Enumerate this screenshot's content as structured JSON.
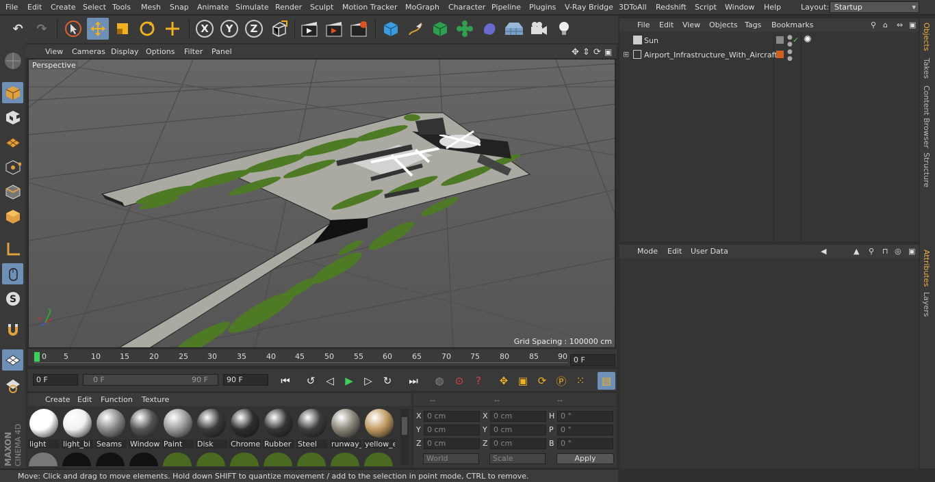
{
  "menubar": {
    "items": [
      "File",
      "Edit",
      "Create",
      "Select",
      "Tools",
      "Mesh",
      "Snap",
      "Animate",
      "Simulate",
      "Render",
      "Sculpt",
      "Motion Tracker",
      "MoGraph",
      "Character",
      "Pipeline",
      "Plugins",
      "V-Ray Bridge",
      "3DToAll",
      "Redshift",
      "Script",
      "Window",
      "Help"
    ],
    "layout_label": "Layout:",
    "layout_value": "Startup"
  },
  "toolbar": {
    "icons": [
      "undo-icon",
      "redo-icon",
      "select-icon",
      "move-icon",
      "scale-icon",
      "rotate-icon",
      "live-select-icon",
      "x-axis-icon",
      "y-axis-icon",
      "z-axis-icon",
      "coordinate-system-icon",
      "render-view-icon",
      "render-picture-viewer-icon",
      "render-settings-icon",
      "cube-icon",
      "pen-icon",
      "subdivision-icon",
      "array-icon",
      "deformer-icon",
      "floor-icon",
      "camera-icon",
      "light-icon"
    ],
    "axis_labels": [
      "X",
      "Y",
      "Z"
    ]
  },
  "viewport": {
    "menu": [
      "View",
      "Cameras",
      "Display",
      "Options",
      "Filter",
      "Panel"
    ],
    "label": "Perspective",
    "grid_spacing": "Grid Spacing : 100000 cm",
    "colors": {
      "bg": "#5b5b5b",
      "grass": "#4f7a25",
      "tarmac": "#b8b8b0"
    }
  },
  "timeline": {
    "ticks": [
      "0",
      "5",
      "10",
      "15",
      "20",
      "25",
      "30",
      "35",
      "40",
      "45",
      "50",
      "55",
      "60",
      "65",
      "70",
      "75",
      "80",
      "85",
      "90"
    ],
    "current_frame": "0 F"
  },
  "playbar": {
    "start": "0 F",
    "range_start": "0 F",
    "range_end": "90 F",
    "end": "90 F"
  },
  "materials": {
    "menu": [
      "Create",
      "Edit",
      "Function",
      "Texture"
    ],
    "items": [
      {
        "name": "light",
        "color": "#ffffff"
      },
      {
        "name": "light_bi",
        "color": "#f0f0f0"
      },
      {
        "name": "Seams",
        "color": "#8a8a8a"
      },
      {
        "name": "Window",
        "color": "#555555"
      },
      {
        "name": "Paint",
        "color": "#9a9a9a"
      },
      {
        "name": "Disk",
        "color": "#3a3a3a"
      },
      {
        "name": "Chrome",
        "color": "#2e2e2e"
      },
      {
        "name": "Rubber",
        "color": "#353535"
      },
      {
        "name": "Steel",
        "color": "#3d3d3d"
      },
      {
        "name": "runway_",
        "color": "#8a8578"
      },
      {
        "name": "yellow_e",
        "color": "#c09a60"
      }
    ]
  },
  "coordinates": {
    "headers": [
      "--",
      "--",
      "--"
    ],
    "rows": [
      {
        "l1": "X",
        "v1": "0 cm",
        "l2": "X",
        "v2": "0 cm",
        "l3": "H",
        "v3": "0 °"
      },
      {
        "l1": "Y",
        "v1": "0 cm",
        "l2": "Y",
        "v2": "0 cm",
        "l3": "P",
        "v3": "0 °"
      },
      {
        "l1": "Z",
        "v1": "0 cm",
        "l2": "Z",
        "v2": "0 cm",
        "l3": "B",
        "v3": "0 °"
      }
    ],
    "mode_world": "World",
    "mode_scale": "Scale",
    "apply": "Apply"
  },
  "status": "Move: Click and drag to move elements. Hold down SHIFT to quantize movement / add to the selection in point mode, CTRL to remove.",
  "objects": {
    "menu": [
      "File",
      "Edit",
      "View",
      "Objects",
      "Tags",
      "Bookmarks"
    ],
    "rows": [
      {
        "name": "Sun",
        "tag_color": "#bbbbbb"
      },
      {
        "name": "Airport_Infrastructure_With_Aircraft",
        "tag_color": "#d06020"
      }
    ]
  },
  "attributes": {
    "menu": [
      "Mode",
      "Edit",
      "User Data"
    ]
  },
  "right_tabs": [
    "Objects",
    "Takes",
    "Content Browser",
    "Structure",
    "Attributes",
    "Layers"
  ],
  "branding": {
    "maxon": "MAXON",
    "cinema": "CINEMA 4D"
  }
}
